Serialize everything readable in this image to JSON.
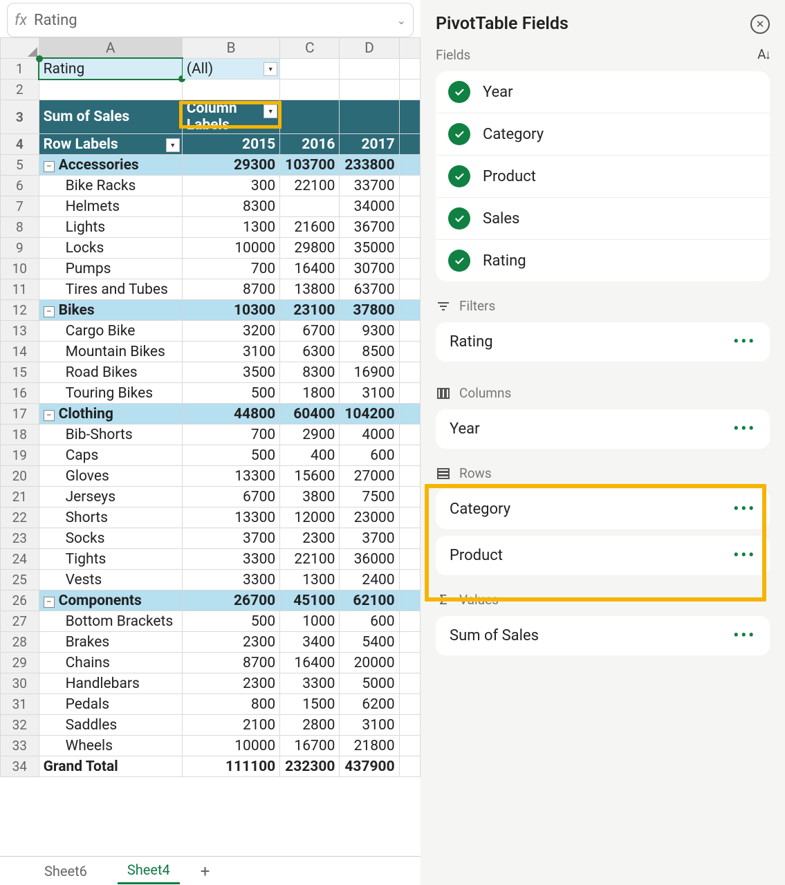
{
  "formula_bar": {
    "fx": "fx",
    "value": "Rating"
  },
  "col_headers": [
    "A",
    "B",
    "C",
    "D"
  ],
  "row_nums": [
    1,
    2,
    3,
    4,
    5,
    6,
    7,
    8,
    9,
    10,
    11,
    12,
    13,
    14,
    15,
    16,
    17,
    18,
    19,
    20,
    21,
    22,
    23,
    24,
    25,
    26,
    27,
    28,
    29,
    30,
    31,
    32,
    33,
    34
  ],
  "r1": {
    "a": "Rating",
    "b": "(All)"
  },
  "r3": {
    "a": "Sum of Sales",
    "b": "Column Labels"
  },
  "r4": {
    "a": "Row Labels",
    "b": "2015",
    "c": "2016",
    "d": "2017"
  },
  "categories": [
    {
      "row": 5,
      "name": "Accessories",
      "vals": [
        "29300",
        "103700",
        "233800"
      ],
      "items": [
        {
          "row": 6,
          "name": "Bike Racks",
          "v": [
            "300",
            "22100",
            "33700"
          ]
        },
        {
          "row": 7,
          "name": "Helmets",
          "v": [
            "8300",
            "",
            "34000"
          ]
        },
        {
          "row": 8,
          "name": "Lights",
          "v": [
            "1300",
            "21600",
            "36700"
          ]
        },
        {
          "row": 9,
          "name": "Locks",
          "v": [
            "10000",
            "29800",
            "35000"
          ]
        },
        {
          "row": 10,
          "name": "Pumps",
          "v": [
            "700",
            "16400",
            "30700"
          ]
        },
        {
          "row": 11,
          "name": "Tires and Tubes",
          "v": [
            "8700",
            "13800",
            "63700"
          ]
        }
      ]
    },
    {
      "row": 12,
      "name": "Bikes",
      "vals": [
        "10300",
        "23100",
        "37800"
      ],
      "items": [
        {
          "row": 13,
          "name": "Cargo Bike",
          "v": [
            "3200",
            "6700",
            "9300"
          ]
        },
        {
          "row": 14,
          "name": "Mountain Bikes",
          "v": [
            "3100",
            "6300",
            "8500"
          ]
        },
        {
          "row": 15,
          "name": "Road Bikes",
          "v": [
            "3500",
            "8300",
            "16900"
          ]
        },
        {
          "row": 16,
          "name": "Touring Bikes",
          "v": [
            "500",
            "1800",
            "3100"
          ]
        }
      ]
    },
    {
      "row": 17,
      "name": "Clothing",
      "vals": [
        "44800",
        "60400",
        "104200"
      ],
      "items": [
        {
          "row": 18,
          "name": "Bib-Shorts",
          "v": [
            "700",
            "2900",
            "4000"
          ]
        },
        {
          "row": 19,
          "name": "Caps",
          "v": [
            "500",
            "400",
            "600"
          ]
        },
        {
          "row": 20,
          "name": "Gloves",
          "v": [
            "13300",
            "15600",
            "27000"
          ]
        },
        {
          "row": 21,
          "name": "Jerseys",
          "v": [
            "6700",
            "3800",
            "7500"
          ]
        },
        {
          "row": 22,
          "name": "Shorts",
          "v": [
            "13300",
            "12000",
            "23000"
          ]
        },
        {
          "row": 23,
          "name": "Socks",
          "v": [
            "3700",
            "2300",
            "3700"
          ]
        },
        {
          "row": 24,
          "name": "Tights",
          "v": [
            "3300",
            "22100",
            "36000"
          ]
        },
        {
          "row": 25,
          "name": "Vests",
          "v": [
            "3300",
            "1300",
            "2400"
          ]
        }
      ]
    },
    {
      "row": 26,
      "name": "Components",
      "vals": [
        "26700",
        "45100",
        "62100"
      ],
      "items": [
        {
          "row": 27,
          "name": "Bottom Brackets",
          "v": [
            "500",
            "1000",
            "600"
          ]
        },
        {
          "row": 28,
          "name": "Brakes",
          "v": [
            "2300",
            "3400",
            "5400"
          ]
        },
        {
          "row": 29,
          "name": "Chains",
          "v": [
            "8700",
            "16400",
            "20000"
          ]
        },
        {
          "row": 30,
          "name": "Handlebars",
          "v": [
            "2300",
            "3300",
            "5000"
          ]
        },
        {
          "row": 31,
          "name": "Pedals",
          "v": [
            "800",
            "1500",
            "6200"
          ]
        },
        {
          "row": 32,
          "name": "Saddles",
          "v": [
            "2100",
            "2800",
            "3100"
          ]
        },
        {
          "row": 33,
          "name": "Wheels",
          "v": [
            "10000",
            "16700",
            "21800"
          ]
        }
      ]
    }
  ],
  "grand_total": {
    "row": 34,
    "name": "Grand Total",
    "v": [
      "111100",
      "232300",
      "437900"
    ]
  },
  "tabs": {
    "t1": "Sheet6",
    "t2": "Sheet4"
  },
  "panel": {
    "title": "PivotTable Fields",
    "fields_label": "Fields",
    "fields": {
      "f1": "Year",
      "f2": "Category",
      "f3": "Product",
      "f4": "Sales",
      "f5": "Rating"
    },
    "filters": {
      "label": "Filters",
      "i1": "Rating"
    },
    "columns": {
      "label": "Columns",
      "i1": "Year"
    },
    "rows": {
      "label": "Rows",
      "i1": "Category",
      "i2": "Product"
    },
    "values": {
      "label": "Values",
      "i1": "Sum of Sales"
    }
  }
}
